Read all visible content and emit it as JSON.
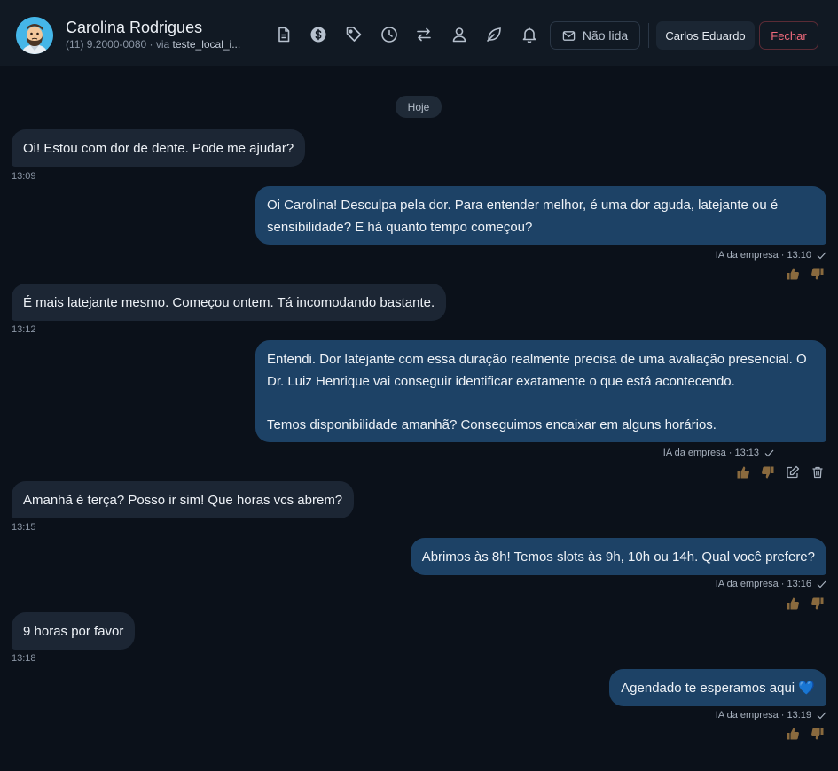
{
  "contact": {
    "name": "Carolina Rodrigues",
    "phone": "(11) 9.2000-0080 · via ",
    "channel": "teste_local_i..."
  },
  "toolbar": {
    "icons": [
      "document-icon",
      "dollar-icon",
      "tag-icon",
      "clock-icon",
      "transfer-icon",
      "user-icon",
      "leaf-icon",
      "bell-icon"
    ],
    "unread_label": "Não lida",
    "agent_label": "Carlos Eduardo",
    "close_label": "Fechar"
  },
  "colors": {
    "incoming_bubble": "#1c2634",
    "outgoing_bubble": "#1d4266",
    "close_accent": "#f06a7c",
    "background": "#0b111a"
  },
  "chat": {
    "day_label": "Hoje",
    "messages": [
      {
        "dir": "in",
        "text": "Oi! Estou com dor de dente. Pode me ajudar?",
        "time": "13:09"
      },
      {
        "dir": "out",
        "text": "Oi Carolina! Desculpa pela dor. Para entender melhor, é uma dor aguda, latejante ou é\nsensibilidade? E há quanto tempo começou?",
        "meta": "IA da empresa · 13:10"
      },
      {
        "dir": "in",
        "text": "É mais latejante mesmo. Começou ontem. Tá incomodando bastante.",
        "time": "13:12"
      },
      {
        "dir": "out",
        "text": "Entendi. Dor latejante com essa duração realmente precisa de uma avaliação presencial. O\nDr. Luiz Henrique vai conseguir identificar exatamente o que está acontecendo.\n\nTemos disponibilidade amanhã? Conseguimos encaixar em alguns horários.",
        "meta": "IA da empresa · 13:13"
      },
      {
        "dir": "in",
        "text": "Amanhã é terça? Posso ir sim! Que horas vcs abrem?",
        "time": "13:15"
      },
      {
        "dir": "out",
        "text": "Abrimos às 8h! Temos slots às 9h, 10h ou 14h. Qual você prefere?",
        "meta": "IA da empresa · 13:16"
      },
      {
        "dir": "in",
        "text": "9 horas por favor",
        "time": "13:18"
      },
      {
        "dir": "out",
        "text": "Agendado te esperamos aqui ",
        "emoji": "💙",
        "meta": "IA da empresa · 13:19"
      }
    ]
  }
}
